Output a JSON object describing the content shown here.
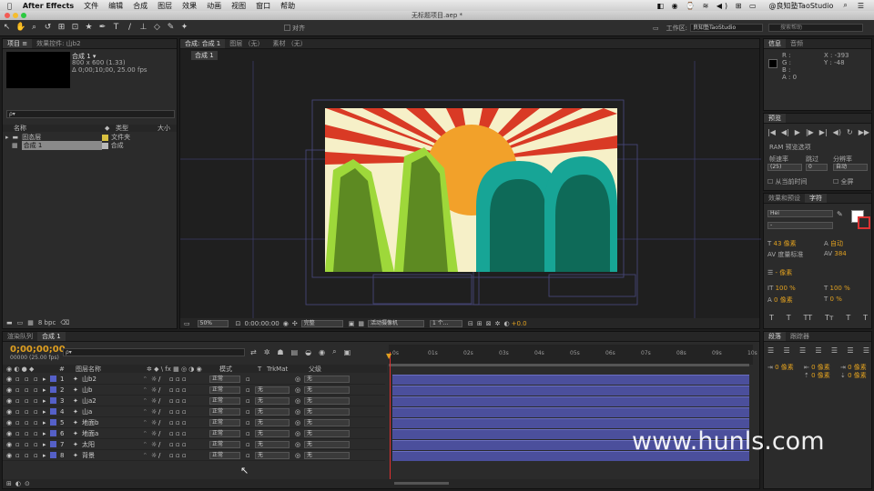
{
  "menubar": {
    "app": "After Effects",
    "items": [
      "文件",
      "编辑",
      "合成",
      "图层",
      "效果",
      "动画",
      "视图",
      "窗口",
      "帮助"
    ],
    "status_user": "@良知塾TaoStudio"
  },
  "window": {
    "title": "无标题项目.aep *"
  },
  "toolbar": {
    "snap_label": "对齐",
    "workspace_label": "工作区:",
    "workspace_value": "良知塾TaoStudio",
    "search_placeholder": "搜索帮助"
  },
  "project": {
    "tabs": [
      "项目 ≡",
      "效果控件: 山b2"
    ],
    "comp_name": "合成 1 ▾",
    "comp_size": "800 x 600 (1.33)",
    "comp_duration": "Δ 0;00;10;00, 25.00 fps",
    "search_placeholder": "ρ▾",
    "columns": {
      "name": "名称",
      "type": "类型",
      "size": "大小"
    },
    "items": [
      {
        "name": "固态层",
        "type": "文件夹",
        "color": "#d8c040"
      },
      {
        "name": "合成 1",
        "type": "合成",
        "color": "#b8b8b8"
      }
    ],
    "bpc": "8 bpc"
  },
  "composition": {
    "tabs": [
      "合成: 合成 1",
      "图层 （无）",
      "素材 （无）"
    ],
    "breadcrumb": "合成 1",
    "zoom": "50%",
    "timecode": "0:00:00:00",
    "quality": "完整",
    "camera": "活动摄像机",
    "view": "1 个...",
    "exposure": "+0.0"
  },
  "info": {
    "tabs": [
      "信息",
      "音频"
    ],
    "r": "R :",
    "g": "G :",
    "b": "B :",
    "a": "A : 0",
    "x": "X : -393",
    "y": "Y : -48"
  },
  "preview": {
    "tabs": [
      "预览"
    ],
    "ram_options": "RAM 预览选项",
    "frame_rate_label": "帧速率",
    "skip_label": "跳过",
    "resolution_label": "分辨率",
    "frame_rate": "(25)",
    "skip": "0",
    "resolution": "自动",
    "from_current": "从当前时间",
    "full_screen": "全屏"
  },
  "character": {
    "tabs": [
      "效果和预设",
      "字符"
    ],
    "font": "Hei",
    "style": "-",
    "size": "43 像素",
    "leading": "自动",
    "tracking_label": "度量标准",
    "tracking": "384",
    "stroke": "- 像素",
    "vscale": "100 %",
    "hscale": "100 %",
    "baseline": "0 像素",
    "tsume": "0 %",
    "styles": [
      "T",
      "T",
      "TT",
      "Tт",
      "T",
      "T"
    ]
  },
  "paragraph": {
    "tabs": [
      "段落",
      "跟踪器"
    ],
    "indent_left": "0 像素",
    "indent_right": "0 像素",
    "first_line": "0 像素",
    "space_before": "0 像素",
    "space_after": "0 像素"
  },
  "timeline": {
    "tabs": [
      "渲染队列",
      "合成 1"
    ],
    "timecode": "0;00;00;00",
    "frames": "00000 (25.00 fps)",
    "columns": {
      "name": "图层名称",
      "mode": "模式",
      "t": "T",
      "trkmat": "TrkMat",
      "parent": "父级"
    },
    "ruler": [
      "0s",
      "01s",
      "02s",
      "03s",
      "04s",
      "05s",
      "06s",
      "07s",
      "08s",
      "09s",
      "10s"
    ],
    "layers": [
      {
        "num": "1",
        "name": "山b2",
        "mode": "正常",
        "trk": "",
        "parent": "无"
      },
      {
        "num": "2",
        "name": "山b",
        "mode": "正常",
        "trk": "无",
        "parent": "无"
      },
      {
        "num": "3",
        "name": "山a2",
        "mode": "正常",
        "trk": "无",
        "parent": "无"
      },
      {
        "num": "4",
        "name": "山a",
        "mode": "正常",
        "trk": "无",
        "parent": "无"
      },
      {
        "num": "5",
        "name": "地面b",
        "mode": "正常",
        "trk": "无",
        "parent": "无"
      },
      {
        "num": "6",
        "name": "地面a",
        "mode": "正常",
        "trk": "无",
        "parent": "无"
      },
      {
        "num": "7",
        "name": "太阳",
        "mode": "正常",
        "trk": "无",
        "parent": "无"
      },
      {
        "num": "8",
        "name": "背景",
        "mode": "正常",
        "trk": "无",
        "parent": "无"
      }
    ],
    "layer_color": "#5560c8"
  },
  "watermark": "www.hunls.com",
  "colors": {
    "accent": "#e0a020",
    "bar": "#4b4f9c",
    "panel": "#2b2b2b"
  }
}
